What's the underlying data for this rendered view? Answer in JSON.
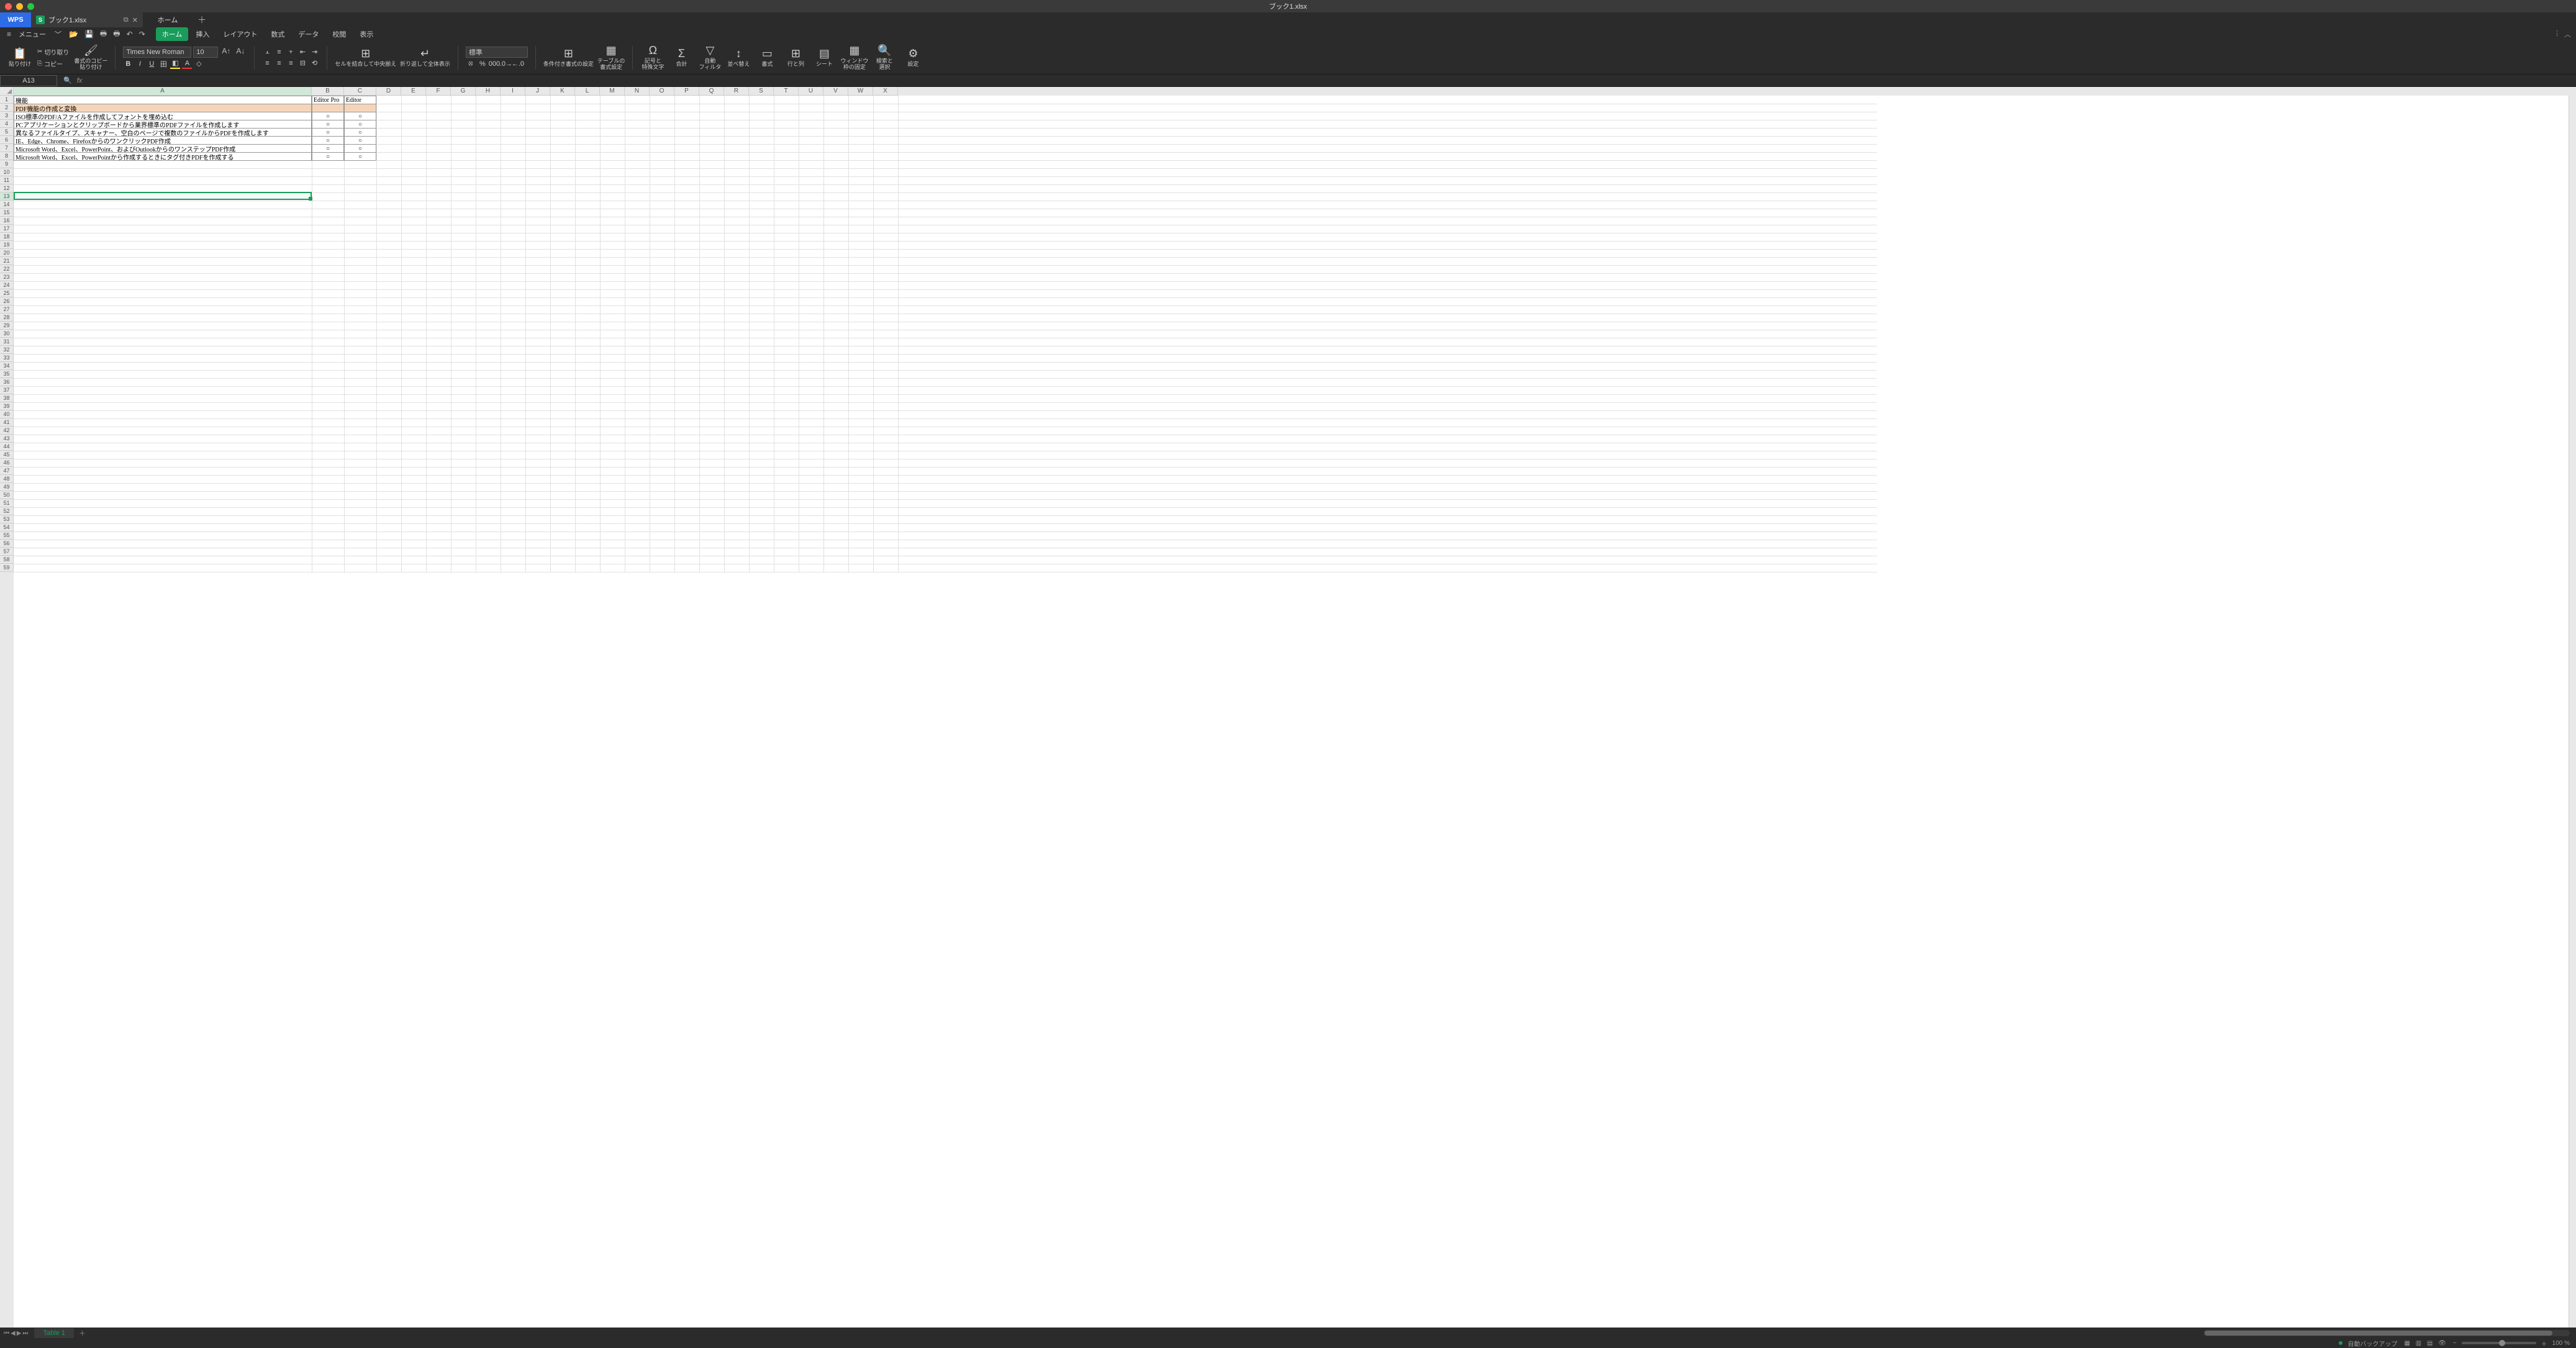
{
  "window": {
    "title": "ブック1.xlsx"
  },
  "tabs": {
    "wps": "WPS",
    "file_name": "ブック1.xlsx",
    "home": "ホーム"
  },
  "menu": {
    "label": "メニュー",
    "tabs": [
      "ホーム",
      "挿入",
      "レイアウト",
      "数式",
      "データ",
      "校閲",
      "表示"
    ],
    "active_index": 0
  },
  "ribbon": {
    "paste": "貼り付け",
    "cut": "切り取り",
    "copy": "コピー",
    "format_painter_l1": "書式のコピー",
    "format_painter_l2": "貼り付け",
    "font_name": "Times New Roman",
    "font_size": "10",
    "merge_center": "セルを結合して中央揃え",
    "wrap_text": "折り返して全体表示",
    "number_format": "標準",
    "conditional_format": "条件付き書式の設定",
    "table_format_l1": "テーブルの",
    "table_format_l2": "書式設定",
    "symbol_l1": "記号と",
    "symbol_l2": "特殊文字",
    "sum": "合計",
    "auto_l1": "自動",
    "auto_l2": "フィルタ",
    "sort": "並べ替え",
    "format": "書式",
    "row_col": "行と列",
    "sheet": "シート",
    "window_l1": "ウィンドウ",
    "window_l2": "枠の固定",
    "find_l1": "検索と",
    "find_l2": "選択",
    "settings": "設定"
  },
  "namebox": {
    "ref": "A13"
  },
  "columns": [
    "A",
    "B",
    "C",
    "D",
    "E",
    "F",
    "G",
    "H",
    "I",
    "J",
    "K",
    "L",
    "M",
    "N",
    "O",
    "P",
    "Q",
    "R",
    "S",
    "T",
    "U",
    "V",
    "W",
    "X"
  ],
  "col_widths": {
    "A": 480,
    "default": 40,
    "B": 52,
    "C": 52
  },
  "row_count": 59,
  "selected_col": "A",
  "selected_row": 13,
  "data_rows": [
    {
      "r": 1,
      "a": "機能",
      "b": "Editor Pro",
      "c": "Editor",
      "hl": false,
      "header": true
    },
    {
      "r": 2,
      "a": "PDF機能の作成と変換",
      "b": "",
      "c": "",
      "hl": true
    },
    {
      "r": 3,
      "a": "ISO標準のPDF/Aファイルを作成してフォントを埋め込む",
      "b": "○",
      "c": "○"
    },
    {
      "r": 4,
      "a": "PCアプリケーションとクリップボードから業界標準のPDFファイルを作成します",
      "b": "○",
      "c": "○"
    },
    {
      "r": 5,
      "a": "異なるファイルタイプ、スキャナー、空白のページで複数のファイルからPDFを作成します",
      "b": "○",
      "c": "○"
    },
    {
      "r": 6,
      "a": "IE、Edge、Chrome、FirefoxからのワンクリックPDF作成",
      "b": "○",
      "c": "○"
    },
    {
      "r": 7,
      "a": "Microsoft Word、Excel、PowerPoint、およびOutlookからのワンステップPDF作成",
      "b": "○",
      "c": "○"
    },
    {
      "r": 8,
      "a": "Microsoft Word、Excel、PowerPointから作成するときにタグ付きPDFを作成する",
      "b": "○",
      "c": "○"
    }
  ],
  "sheet": {
    "name": "Table 1"
  },
  "status": {
    "backup": "自動バックアップ",
    "zoom": "100 %"
  }
}
